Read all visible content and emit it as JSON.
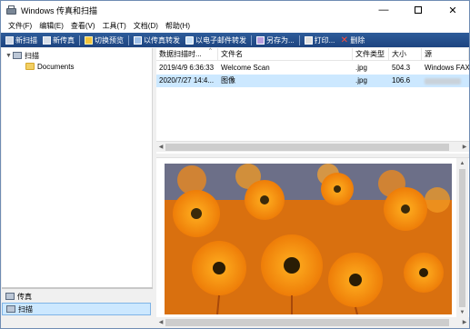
{
  "window": {
    "title": "Windows 传真和扫描"
  },
  "window_controls": {
    "minimize": "—",
    "close": "✕"
  },
  "menu": [
    "文件(F)",
    "编辑(E)",
    "查看(V)",
    "工具(T)",
    "文档(D)",
    "帮助(H)"
  ],
  "toolbar": {
    "new_scan": "新扫描",
    "new_fax": "新传真",
    "toggle_preview": "切换预览",
    "forward_as_fax": "以传真转发",
    "forward_as_email": "以电子邮件转发",
    "save_as": "另存为...",
    "print": "打印...",
    "delete": "删除"
  },
  "tree": {
    "root": "扫描",
    "child": "Documents"
  },
  "nav": {
    "fax": "传真",
    "scan": "扫描"
  },
  "list": {
    "columns": [
      "数据扫描时...",
      "文件名",
      "文件类型",
      "大小",
      "源"
    ],
    "rows": [
      {
        "date": "2019/4/9 6:36:33",
        "name": "Welcome Scan",
        "type": ".jpg",
        "size": "504.3",
        "source": "Windows FAX"
      },
      {
        "date": "2020/7/27 14:4...",
        "name": "图像",
        "type": ".jpg",
        "size": "106.6",
        "source": ""
      }
    ]
  },
  "preview": {
    "subject": "orange daisy flowers photo"
  },
  "colors": {
    "toolbar": "#2e5c9a",
    "selection": "#cce8ff",
    "flower": "#f08a10"
  }
}
